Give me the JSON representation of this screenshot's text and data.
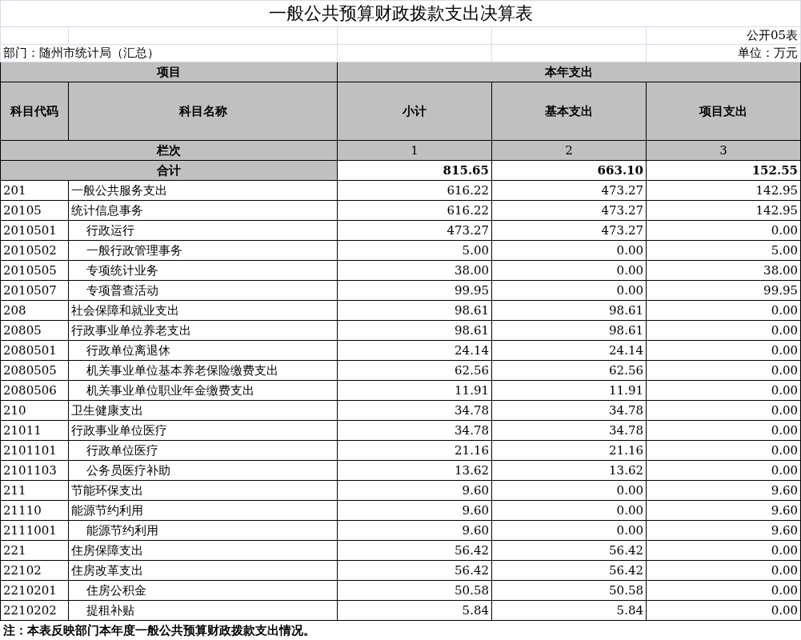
{
  "title": "一般公共预算财政拨款支出决算表",
  "form_no": "公开05表",
  "department": "部门：随州市统计局（汇总）",
  "unit": "单位：万元",
  "header": {
    "group_left": "项目",
    "group_right": "本年支出",
    "code": "科目代码",
    "name": "科目名称",
    "columns": [
      "小计",
      "基本支出",
      "项目支出"
    ],
    "index_label": "栏次",
    "indexes": [
      "1",
      "2",
      "3"
    ]
  },
  "total": {
    "label": "合计",
    "values": [
      "815.65",
      "663.10",
      "152.55"
    ]
  },
  "rows": [
    {
      "code": "201",
      "name": "一般公共服务支出",
      "values": [
        "616.22",
        "473.27",
        "142.95"
      ],
      "children": [
        {
          "code": "20105",
          "name": "统计信息事务",
          "values": [
            "616.22",
            "473.27",
            "142.95"
          ],
          "children": [
            {
              "code": "2010501",
              "name": "行政运行",
              "values": [
                "473.27",
                "473.27",
                "0.00"
              ]
            },
            {
              "code": "2010502",
              "name": "一般行政管理事务",
              "values": [
                "5.00",
                "0.00",
                "5.00"
              ]
            },
            {
              "code": "2010505",
              "name": "专项统计业务",
              "values": [
                "38.00",
                "0.00",
                "38.00"
              ]
            },
            {
              "code": "2010507",
              "name": "专项普查活动",
              "values": [
                "99.95",
                "0.00",
                "99.95"
              ]
            }
          ]
        }
      ]
    },
    {
      "code": "208",
      "name": "社会保障和就业支出",
      "values": [
        "98.61",
        "98.61",
        "0.00"
      ],
      "children": [
        {
          "code": "20805",
          "name": "行政事业单位养老支出",
          "values": [
            "98.61",
            "98.61",
            "0.00"
          ],
          "children": [
            {
              "code": "2080501",
              "name": "行政单位离退休",
              "values": [
                "24.14",
                "24.14",
                "0.00"
              ]
            },
            {
              "code": "2080505",
              "name": "机关事业单位基本养老保险缴费支出",
              "values": [
                "62.56",
                "62.56",
                "0.00"
              ]
            },
            {
              "code": "2080506",
              "name": "机关事业单位职业年金缴费支出",
              "values": [
                "11.91",
                "11.91",
                "0.00"
              ]
            }
          ]
        }
      ]
    },
    {
      "code": "210",
      "name": "卫生健康支出",
      "values": [
        "34.78",
        "34.78",
        "0.00"
      ],
      "children": [
        {
          "code": "21011",
          "name": "行政事业单位医疗",
          "values": [
            "34.78",
            "34.78",
            "0.00"
          ],
          "children": [
            {
              "code": "2101101",
              "name": "行政单位医疗",
              "values": [
                "21.16",
                "21.16",
                "0.00"
              ]
            },
            {
              "code": "2101103",
              "name": "公务员医疗补助",
              "values": [
                "13.62",
                "13.62",
                "0.00"
              ]
            }
          ]
        }
      ]
    },
    {
      "code": "211",
      "name": "节能环保支出",
      "values": [
        "9.60",
        "0.00",
        "9.60"
      ],
      "children": [
        {
          "code": "21110",
          "name": "能源节约利用",
          "values": [
            "9.60",
            "0.00",
            "9.60"
          ],
          "children": [
            {
              "code": "2111001",
              "name": "能源节约利用",
              "values": [
                "9.60",
                "0.00",
                "9.60"
              ]
            }
          ]
        }
      ]
    },
    {
      "code": "221",
      "name": "住房保障支出",
      "values": [
        "56.42",
        "56.42",
        "0.00"
      ],
      "children": [
        {
          "code": "22102",
          "name": "住房改革支出",
          "values": [
            "56.42",
            "56.42",
            "0.00"
          ],
          "children": [
            {
              "code": "2210201",
              "name": "住房公积金",
              "values": [
                "50.58",
                "50.58",
                "0.00"
              ]
            },
            {
              "code": "2210202",
              "name": "提租补贴",
              "values": [
                "5.84",
                "5.84",
                "0.00"
              ]
            }
          ]
        }
      ]
    }
  ],
  "note": "注：本表反映部门本年度一般公共预算财政拨款支出情况。"
}
